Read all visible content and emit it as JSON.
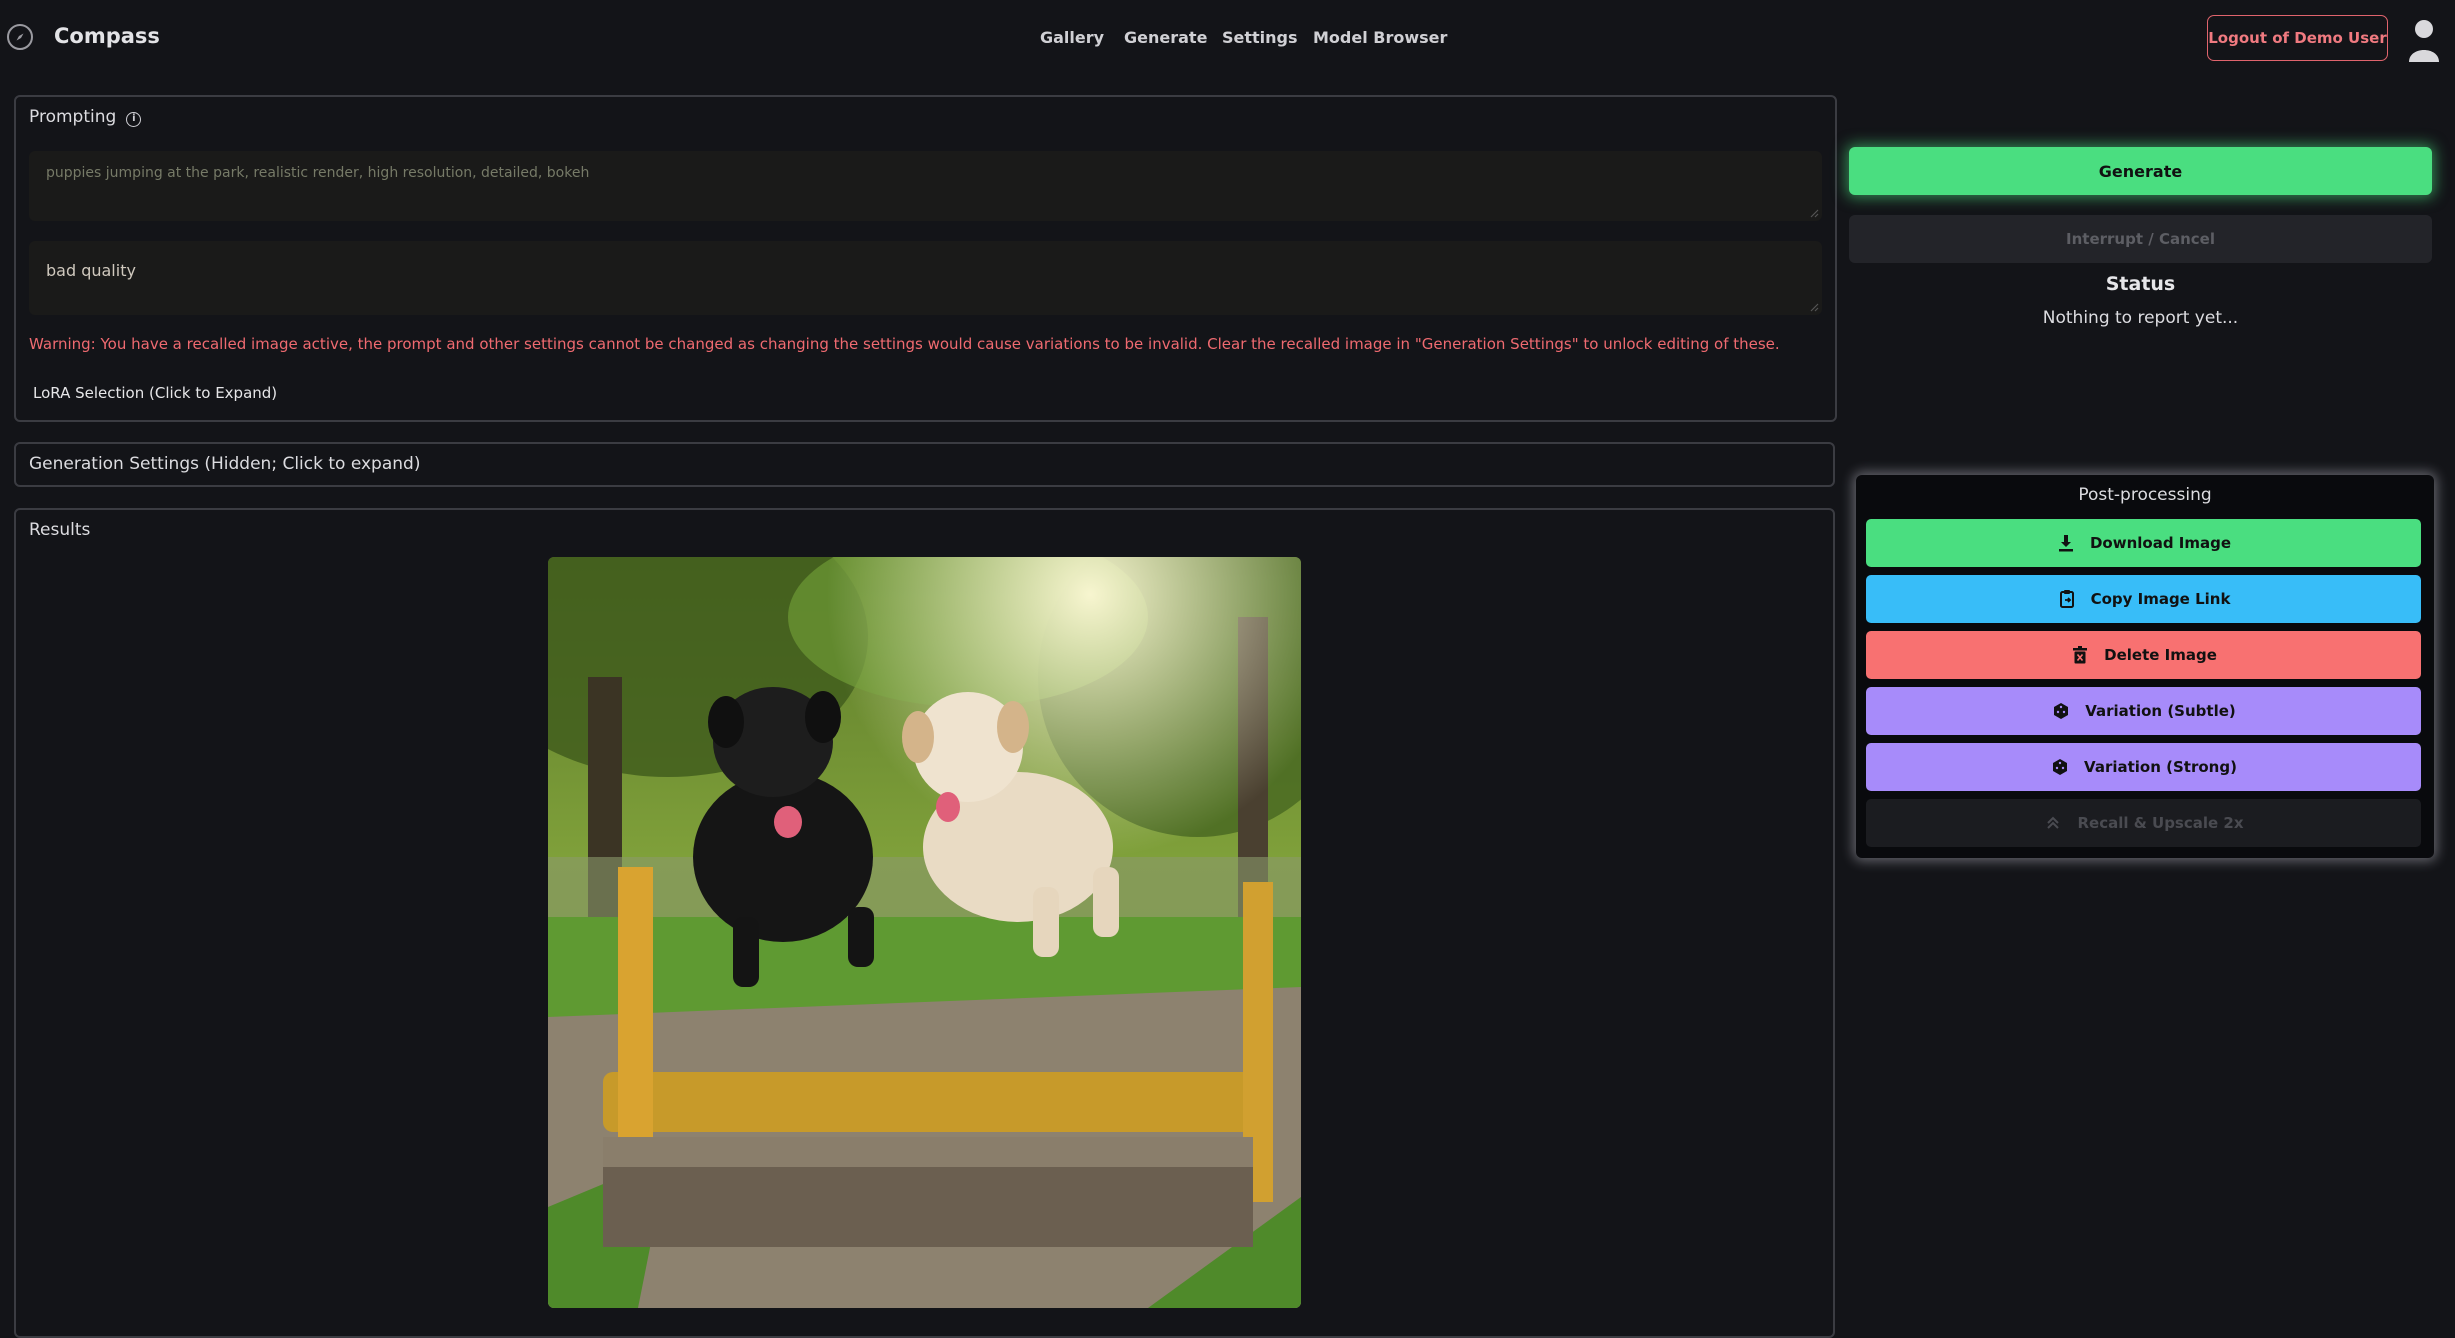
{
  "app": {
    "brand": "Compass",
    "nav": [
      "Gallery",
      "Generate",
      "Settings",
      "Model Browser"
    ],
    "logout_label": "Logout of Demo User"
  },
  "prompting": {
    "title": "Prompting",
    "positive_placeholder": "puppies jumping at the park, realistic render, high resolution, detailed, bokeh",
    "negative_value": "bad quality",
    "warning": "Warning: You have a recalled image active, the prompt and other settings cannot be changed as changing the settings would cause variations to be invalid. Clear the recalled image in \"Generation Settings\" to unlock editing of these.",
    "lora_label": "LoRA Selection (Click to Expand)"
  },
  "generation_settings": {
    "label": "Generation Settings (Hidden; Click to expand)"
  },
  "results": {
    "title": "Results"
  },
  "controls": {
    "generate_label": "Generate",
    "cancel_label": "Interrupt / Cancel",
    "status_title": "Status",
    "status_text": "Nothing to report yet..."
  },
  "postprocessing": {
    "title": "Post-processing",
    "download_label": "Download Image",
    "copy_link_label": "Copy Image Link",
    "delete_label": "Delete Image",
    "variation_subtle_label": "Variation (Subtle)",
    "variation_strong_label": "Variation (Strong)",
    "upscale_label": "Recall & Upscale 2x"
  },
  "colors": {
    "background": "#131418",
    "generate": "#4ade80",
    "download": "#4ade80",
    "copy_link": "#38bdf8",
    "delete": "#f87171",
    "variation": "#a78bfa",
    "warning_text": "#ef6a70"
  },
  "icons": {
    "logo": "compass-icon",
    "avatar": "user-icon",
    "info": "info-icon",
    "download": "download-icon",
    "copy_link": "clipboard-icon",
    "delete": "trash-icon",
    "variation": "dice-icon",
    "upscale": "chevrons-up-icon"
  }
}
